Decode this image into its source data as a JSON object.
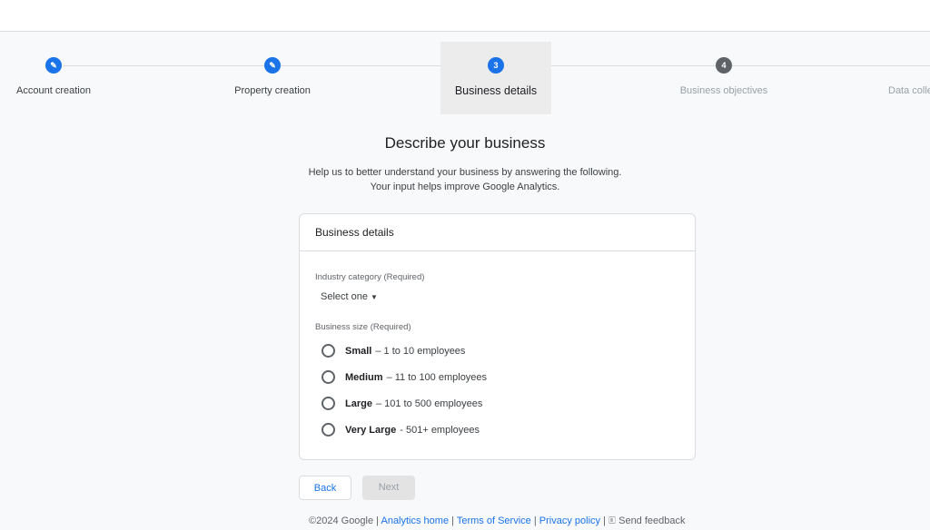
{
  "steps": [
    {
      "label": "Account creation",
      "state": "done",
      "icon": "pencil-icon"
    },
    {
      "label": "Property creation",
      "state": "done",
      "icon": "pencil-icon"
    },
    {
      "label": "Business details",
      "state": "active",
      "number": "3"
    },
    {
      "label": "Business objectives",
      "state": "pending",
      "number": "4"
    },
    {
      "label": "Data collection",
      "state": "pending"
    }
  ],
  "page": {
    "title": "Describe your business",
    "subtitle_1": "Help us to better understand your business by answering the following.",
    "subtitle_2": "Your input helps improve Google Analytics."
  },
  "card": {
    "header": "Business details",
    "industry_label": "Industry category (Required)",
    "industry_value": "Select one",
    "size_label": "Business size (Required)",
    "options": [
      {
        "name": "Small",
        "detail": "– 1 to 10 employees"
      },
      {
        "name": "Medium",
        "detail": "– 11 to 100 employees"
      },
      {
        "name": "Large",
        "detail": "– 101 to 500 employees"
      },
      {
        "name": "Very Large",
        "detail": "- 501+ employees"
      }
    ]
  },
  "buttons": {
    "back": "Back",
    "next": "Next"
  },
  "footer": {
    "copyright": "©2024 Google",
    "analytics_home": "Analytics home",
    "terms": "Terms of Service",
    "privacy": "Privacy policy",
    "feedback": "Send feedback"
  },
  "colors": {
    "accent": "#1a73e8",
    "pending": "#5f6368",
    "background": "#f8f9fa"
  }
}
